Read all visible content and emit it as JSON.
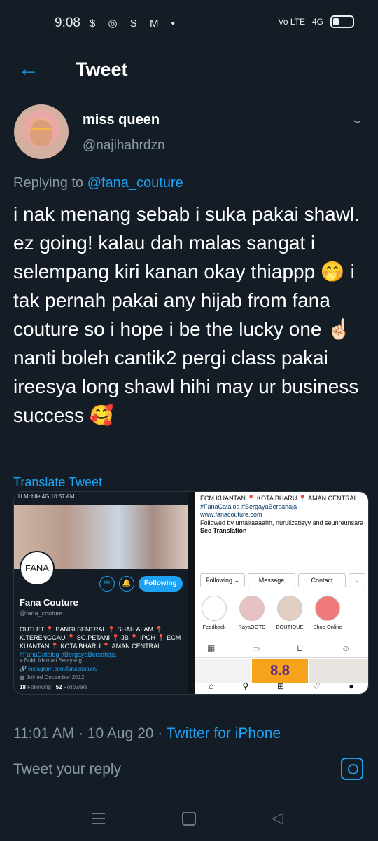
{
  "status_bar": {
    "time": "9:08",
    "notification_icons": [
      "dollar-icon",
      "instagram-icon",
      "shopify-icon",
      "gmail-icon",
      "dot-icon"
    ],
    "notification_glyphs": "$ ◎ S M •",
    "volte": "Vo LTE",
    "network": "4G"
  },
  "header": {
    "title": "Tweet"
  },
  "tweet": {
    "author_name": "miss queen",
    "author_handle": "@najihahrdzn",
    "replying_prefix": "Replying to",
    "replying_to": "@fana_couture",
    "text": "i nak menang sebab i suka pakai shawl. ez going! kalau dah malas sangat i selempang kiri kanan okay thiappp 🤭 i tak pernah pakai any hijab from fana couture so i hope i be the lucky one ☝🏻 nanti boleh cantik2 pergi class pakai ireesya long shawl hihi may ur business success 🥰",
    "translate_label": "Translate Tweet",
    "time": "11:01 AM",
    "date": "10 Aug 20",
    "separator": " · ",
    "source": "Twitter for iPhone"
  },
  "image_left": {
    "mini_status": "U Mobile 4G    10:57 AM",
    "logo_text": "FANA",
    "follow_label": "Following",
    "name": "Fana Couture",
    "handle": "@fana_couture",
    "bio": "OUTLET 📍 BANGI SENTRAL 📍 SHAH ALAM 📍 K.TERENGGAU 📍 SG.PETANI 📍 JB 📍 IPOH 📍 ECM KUANTAN 📍 KOTA BHARU 📍 AMAN CENTRAL",
    "bio_tags": "#FanaCatalog #BergayaBersahaja",
    "location": "Bukit Idaman Selayang",
    "website": "instagram.com/fanacouture/",
    "joined": "Joined December 2012",
    "following_count": "18",
    "following_label": "Following",
    "followers_count": "52",
    "followers_label": "Followers"
  },
  "image_right": {
    "bio": "ECM KUANTAN 📍 KOTA BHARU 📍 AMAN CENTRAL",
    "tags": "#FanaCatalog #BergayaBersahaja",
    "website": "www.fanacouture.com",
    "followed_by": "Followed by umairaaaahh, nurulizatieyy and seunreunsara",
    "see_translation": "See Translation",
    "buttons": [
      "Following ⌄",
      "Message",
      "Contact",
      "⌄"
    ],
    "highlights": [
      "Feedback",
      "RayaOOTD",
      "BOUTIQUE",
      "Shop Online"
    ],
    "promo": "8.8"
  },
  "reply": {
    "placeholder": "Tweet your reply"
  },
  "colors": {
    "accent": "#1da1f2",
    "background": "#141d26",
    "muted": "#8899a6"
  }
}
